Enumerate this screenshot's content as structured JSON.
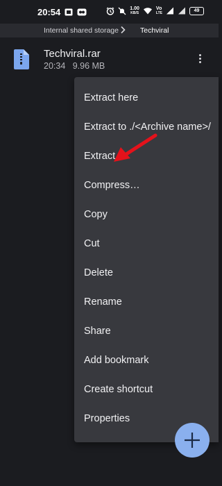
{
  "status_bar": {
    "time": "20:54",
    "net_speed_value": "1.00",
    "net_speed_unit": "KB/S",
    "volte_top": "Vo",
    "volte_bottom": "LTE",
    "battery": "49"
  },
  "breadcrumb": {
    "items": [
      "Internal shared storage",
      "Techviral"
    ]
  },
  "file": {
    "name": "Techviral.rar",
    "time": "20:34",
    "size": "9.96 MB"
  },
  "menu": {
    "items": [
      "Extract here",
      "Extract to ./<Archive name>/",
      "Extract…",
      "Compress…",
      "Copy",
      "Cut",
      "Delete",
      "Rename",
      "Share",
      "Add bookmark",
      "Create shortcut",
      "Properties"
    ]
  },
  "colors": {
    "background": "#1b1c20",
    "breadcrumb_bar": "#2a2b30",
    "menu_background": "#38393e",
    "fab": "#8ab0ee",
    "file_icon": "#7ba6ee",
    "annotation_arrow": "#e4121b"
  },
  "icons": {
    "file": "archive-file-icon",
    "more": "more-vert-icon",
    "fab": "plus-icon",
    "breadcrumb_separator": "chevron-right-icon"
  }
}
